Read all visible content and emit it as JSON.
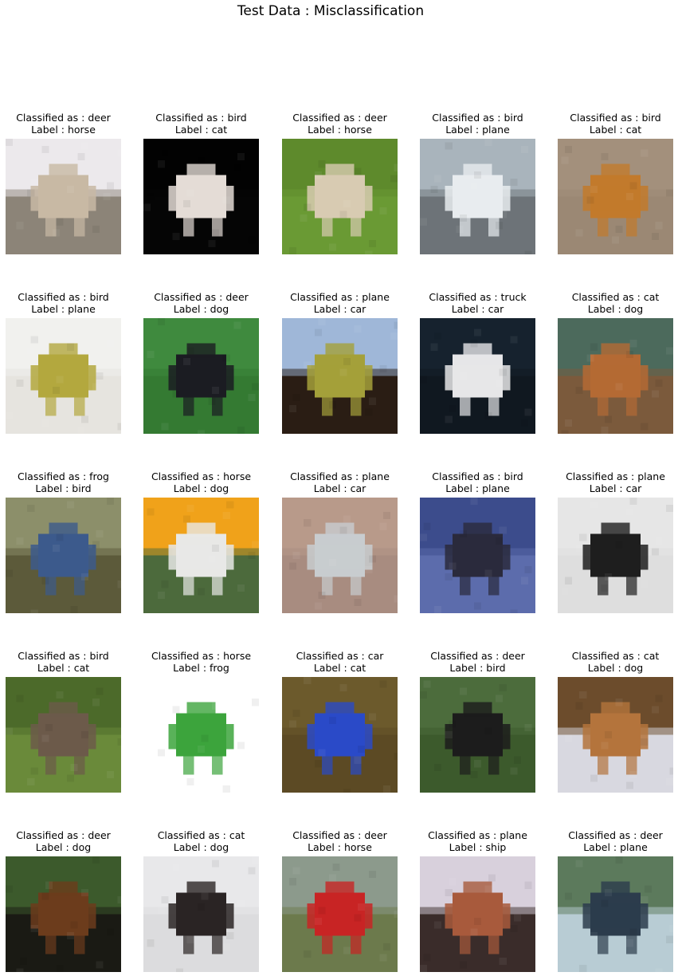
{
  "title": "Test Data : Misclassification",
  "caption_prefix_classified": "Classified as : ",
  "caption_prefix_label": "Label : ",
  "grid": {
    "rows": 5,
    "cols": 5,
    "cells": [
      {
        "classified": "deer",
        "label": "horse",
        "scene": "horse-standing-field",
        "colors": {
          "sky": "#ece9ec",
          "ground": "#8c8478",
          "subject": "#c8b9a4"
        }
      },
      {
        "classified": "bird",
        "label": "cat",
        "scene": "white-cat-dark-bg",
        "colors": {
          "sky": "#020202",
          "ground": "#050505",
          "subject": "#e4dcd6"
        }
      },
      {
        "classified": "deer",
        "label": "horse",
        "scene": "horse-grazing-grass",
        "colors": {
          "sky": "#5e8a2c",
          "ground": "#6a9a34",
          "subject": "#d8cbb2"
        }
      },
      {
        "classified": "bird",
        "label": "plane",
        "scene": "airliner-at-gate",
        "colors": {
          "sky": "#a9b4bc",
          "ground": "#6d7378",
          "subject": "#e8ecef"
        }
      },
      {
        "classified": "bird",
        "label": "cat",
        "scene": "orange-cat-lying",
        "colors": {
          "sky": "#a3907c",
          "ground": "#9b8874",
          "subject": "#c27a2c"
        }
      },
      {
        "classified": "bird",
        "label": "plane",
        "scene": "yellow-toy-plane",
        "colors": {
          "sky": "#f1f1ee",
          "ground": "#e6e4df",
          "subject": "#b3a83e"
        }
      },
      {
        "classified": "deer",
        "label": "dog",
        "scene": "black-dog-on-grass",
        "colors": {
          "sky": "#3f8a3e",
          "ground": "#347a32",
          "subject": "#1b1c22"
        }
      },
      {
        "classified": "plane",
        "label": "car",
        "scene": "car-with-roof-tent",
        "colors": {
          "sky": "#9fb7d8",
          "ground": "#2a1d14",
          "subject": "#a4a03a"
        }
      },
      {
        "classified": "truck",
        "label": "car",
        "scene": "white-pickup-truck",
        "colors": {
          "sky": "#16222e",
          "ground": "#101820",
          "subject": "#e6e6e8"
        }
      },
      {
        "classified": "cat",
        "label": "dog",
        "scene": "fluffy-brown-dog",
        "colors": {
          "sky": "#4c6a5c",
          "ground": "#7b5a3c",
          "subject": "#b46a34"
        }
      },
      {
        "classified": "frog",
        "label": "bird",
        "scene": "blue-jay-on-branches",
        "colors": {
          "sky": "#8c8f6a",
          "ground": "#5c5a3a",
          "subject": "#3c5a8c"
        }
      },
      {
        "classified": "horse",
        "label": "dog",
        "scene": "framed-dog-photo",
        "colors": {
          "sky": "#f0a21a",
          "ground": "#4c6a3c",
          "subject": "#e8e8e6"
        }
      },
      {
        "classified": "plane",
        "label": "car",
        "scene": "silver-minivan",
        "colors": {
          "sky": "#b89a8a",
          "ground": "#a88c80",
          "subject": "#c8cccf"
        }
      },
      {
        "classified": "bird",
        "label": "plane",
        "scene": "jet-with-smoke",
        "colors": {
          "sky": "#3c4c8c",
          "ground": "#5c6cac",
          "subject": "#2a2a3c"
        }
      },
      {
        "classified": "plane",
        "label": "car",
        "scene": "police-toy-car",
        "colors": {
          "sky": "#e6e6e6",
          "ground": "#dedede",
          "subject": "#1e1e1e"
        }
      },
      {
        "classified": "bird",
        "label": "cat",
        "scene": "kitten-in-grass",
        "colors": {
          "sky": "#4c6a2a",
          "ground": "#6a8a3a",
          "subject": "#6c5a4a"
        }
      },
      {
        "classified": "horse",
        "label": "frog",
        "scene": "red-eyed-tree-frog",
        "colors": {
          "sky": "#ffffff",
          "ground": "#ffffff",
          "subject": "#3ca43c"
        }
      },
      {
        "classified": "car",
        "label": "cat",
        "scene": "teddy-in-blue-car",
        "colors": {
          "sky": "#6c5a2c",
          "ground": "#5c4a24",
          "subject": "#2a4ac8"
        }
      },
      {
        "classified": "deer",
        "label": "bird",
        "scene": "dark-bird-in-reeds",
        "colors": {
          "sky": "#4c6c3c",
          "ground": "#3c5a2c",
          "subject": "#1c1c1c"
        }
      },
      {
        "classified": "cat",
        "label": "dog",
        "scene": "sleeping-puppy",
        "colors": {
          "sky": "#6c4c2c",
          "ground": "#d8d8e0",
          "subject": "#b4743c"
        }
      },
      {
        "classified": "deer",
        "label": "dog",
        "scene": "rottweiler-portrait",
        "colors": {
          "sky": "#3c5a2c",
          "ground": "#1a1a14",
          "subject": "#6c3c1c"
        }
      },
      {
        "classified": "cat",
        "label": "dog",
        "scene": "white-dog-pale-bg",
        "colors": {
          "sky": "#e8e8ea",
          "ground": "#dcdcde",
          "subject": "#2a2424"
        }
      },
      {
        "classified": "deer",
        "label": "horse",
        "scene": "rider-on-horse",
        "colors": {
          "sky": "#8c9a8c",
          "ground": "#6c7a4c",
          "subject": "#c82424"
        }
      },
      {
        "classified": "plane",
        "label": "ship",
        "scene": "ship-hull-close",
        "colors": {
          "sky": "#d8d0dc",
          "ground": "#3a2c2a",
          "subject": "#a85a3c"
        }
      },
      {
        "classified": "deer",
        "label": "plane",
        "scene": "seaplane-on-water",
        "colors": {
          "sky": "#5c7a5c",
          "ground": "#b8ccd4",
          "subject": "#2c3c4c"
        }
      }
    ]
  }
}
